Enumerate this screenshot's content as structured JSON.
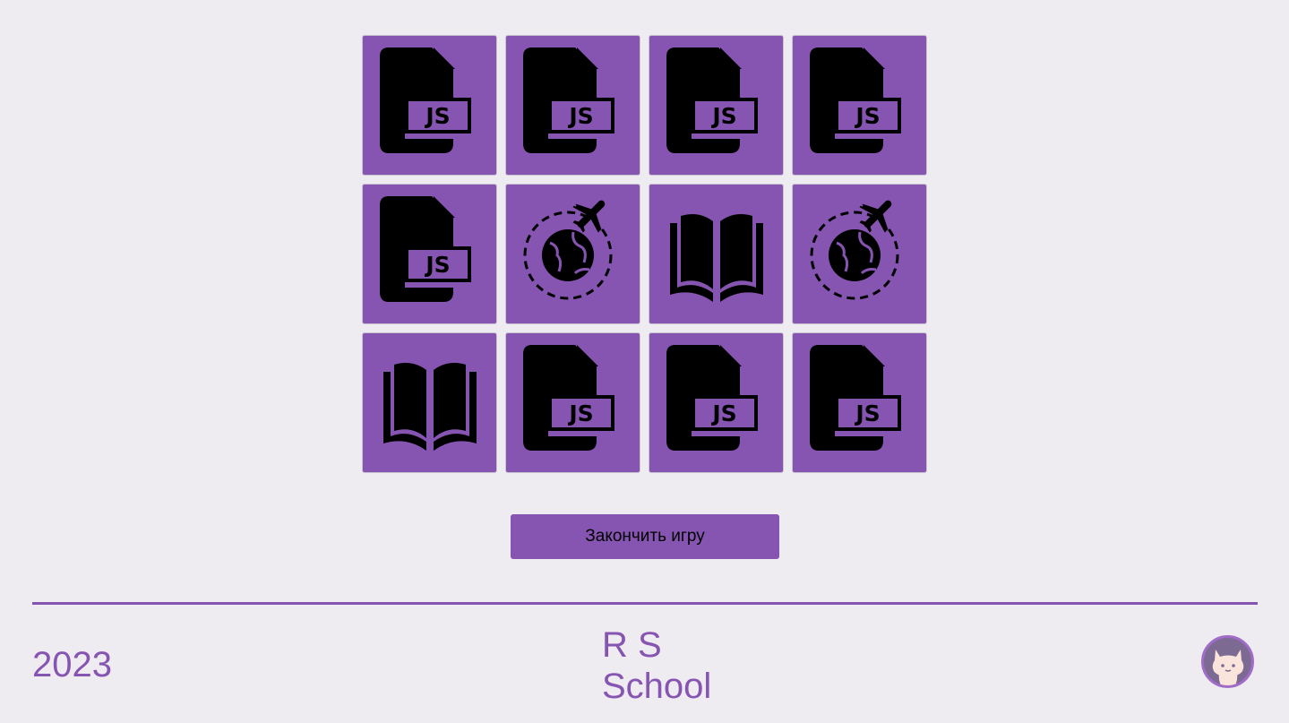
{
  "game": {
    "cards": [
      {
        "icon": "js-file-icon"
      },
      {
        "icon": "js-file-icon"
      },
      {
        "icon": "js-file-icon"
      },
      {
        "icon": "js-file-icon"
      },
      {
        "icon": "js-file-icon"
      },
      {
        "icon": "globe-airplane-icon"
      },
      {
        "icon": "open-book-icon"
      },
      {
        "icon": "globe-airplane-icon"
      },
      {
        "icon": "open-book-icon"
      },
      {
        "icon": "js-file-icon"
      },
      {
        "icon": "js-file-icon"
      },
      {
        "icon": "js-file-icon"
      }
    ],
    "js_badge_text": "JS",
    "end_button_label": "Закончить игру"
  },
  "footer": {
    "year": "2023",
    "school_line1": "R S",
    "school_line2": "School",
    "github_icon": "github-octocat-icon"
  },
  "colors": {
    "accent": "#8654b1",
    "background": "#eeebf1",
    "icon": "#000000"
  }
}
